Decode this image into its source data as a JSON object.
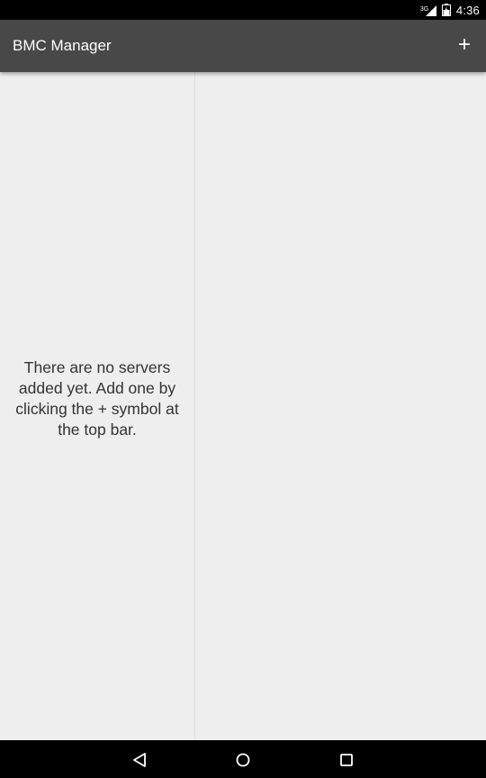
{
  "status_bar": {
    "network_type": "3G",
    "time": "4:36",
    "icons": [
      "signal-icon",
      "battery-icon"
    ]
  },
  "app_bar": {
    "title": "BMC Manager",
    "add_label": "+"
  },
  "content": {
    "empty_message": "There are no servers added yet. Add one by clicking the + symbol at the top bar."
  },
  "nav_bar": {
    "icons": [
      "back-icon",
      "home-icon",
      "recents-icon"
    ]
  },
  "colors": {
    "status_bar_bg": "#000000",
    "app_bar_bg": "#484848",
    "content_bg": "#eeeeee",
    "nav_bar_bg": "#000000"
  }
}
